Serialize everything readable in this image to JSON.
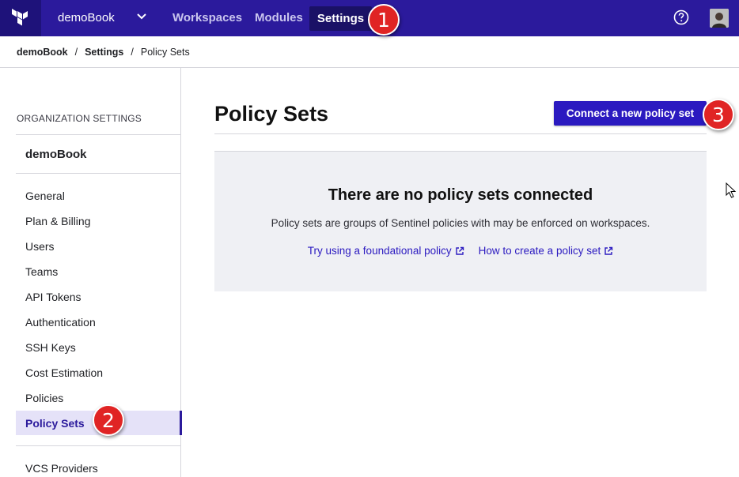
{
  "topbar": {
    "org_name": "demoBook",
    "nav": {
      "workspaces": "Workspaces",
      "modules": "Modules",
      "settings": "Settings"
    },
    "icons": {
      "logo": "terraform-logo-icon",
      "org_switcher": "chevron-down-icon",
      "help": "help-circle-icon",
      "avatar": "user-avatar"
    }
  },
  "breadcrumb": {
    "items": [
      "demoBook",
      "Settings"
    ],
    "separator": "/",
    "current": "Policy Sets"
  },
  "sidebar": {
    "heading": "ORGANIZATION SETTINGS",
    "org_name": "demoBook",
    "items": [
      {
        "label": "General"
      },
      {
        "label": "Plan & Billing"
      },
      {
        "label": "Users"
      },
      {
        "label": "Teams"
      },
      {
        "label": "API Tokens"
      },
      {
        "label": "Authentication"
      },
      {
        "label": "SSH Keys"
      },
      {
        "label": "Cost Estimation"
      },
      {
        "label": "Policies"
      },
      {
        "label": "Policy Sets",
        "active": true
      },
      {
        "label": "VCS Providers"
      }
    ]
  },
  "main": {
    "title": "Policy Sets",
    "connect_button": "Connect a new policy set",
    "empty_state": {
      "title": "There are no policy sets connected",
      "description": "Policy sets are groups of Sentinel policies with may be enforced on workspaces.",
      "links": [
        {
          "label": "Try using a foundational policy",
          "icon": "external-link-icon"
        },
        {
          "label": "How to create a policy set",
          "icon": "external-link-icon"
        }
      ]
    }
  },
  "annotations": [
    "1",
    "2",
    "3"
  ],
  "colors": {
    "topbar": "#2b1a9c",
    "accent": "#2b1ac0",
    "badge": "#e02424",
    "active_item_bg": "#e5e2f8",
    "panel_bg": "#eff0f4"
  }
}
